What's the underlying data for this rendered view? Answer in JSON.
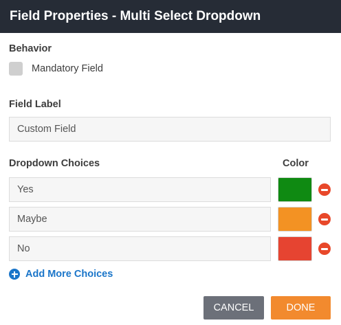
{
  "dialog": {
    "title": "Field Properties - Multi Select Dropdown"
  },
  "behavior": {
    "heading": "Behavior",
    "mandatory_label": "Mandatory Field",
    "mandatory_checked": false
  },
  "field_label": {
    "heading": "Field Label",
    "value": "Custom Field"
  },
  "choices": {
    "heading": "Dropdown Choices",
    "color_heading": "Color",
    "items": [
      {
        "label": "Yes",
        "color": "#0f8a12"
      },
      {
        "label": "Maybe",
        "color": "#f39223"
      },
      {
        "label": "No",
        "color": "#e64431"
      }
    ],
    "add_more_label": "Add More Choices"
  },
  "actions": {
    "cancel_label": "CANCEL",
    "done_label": "DONE"
  },
  "colors": {
    "titlebar": "#262c36",
    "accent_blue": "#1a75c9",
    "done_orange": "#f28a2e",
    "cancel_gray": "#6c7079",
    "remove_red": "#e8482a"
  }
}
